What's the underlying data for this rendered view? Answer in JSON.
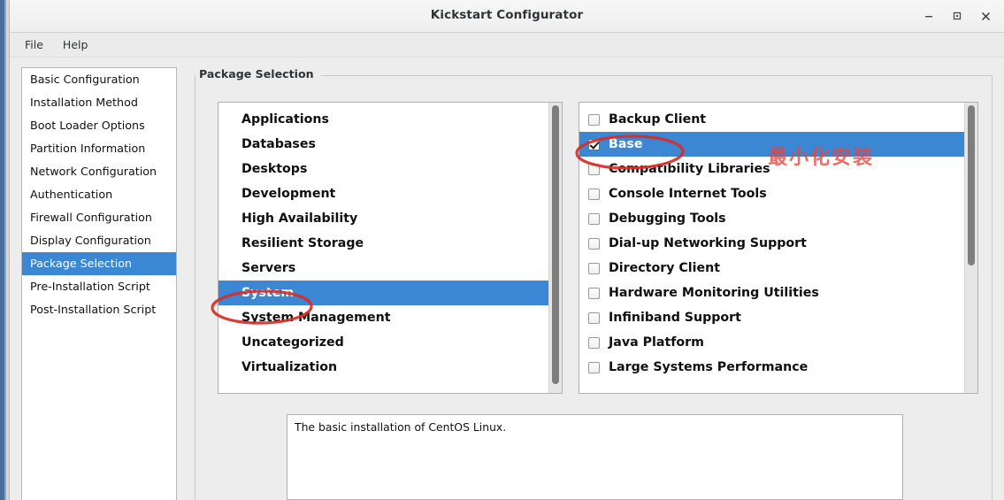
{
  "window": {
    "title": "Kickstart Configurator",
    "controls": [
      {
        "name": "minimize",
        "glyph": "—"
      },
      {
        "name": "maximize",
        "glyph": "□"
      },
      {
        "name": "close",
        "glyph": "✕"
      }
    ]
  },
  "menubar": {
    "items": [
      "File",
      "Help"
    ]
  },
  "sidebar": {
    "items": [
      {
        "label": "Basic Configuration",
        "selected": false
      },
      {
        "label": "Installation Method",
        "selected": false
      },
      {
        "label": "Boot Loader Options",
        "selected": false
      },
      {
        "label": "Partition Information",
        "selected": false
      },
      {
        "label": "Network Configuration",
        "selected": false
      },
      {
        "label": "Authentication",
        "selected": false
      },
      {
        "label": "Firewall Configuration",
        "selected": false
      },
      {
        "label": "Display Configuration",
        "selected": false
      },
      {
        "label": "Package Selection",
        "selected": true
      },
      {
        "label": "Pre-Installation Script",
        "selected": false
      },
      {
        "label": "Post-Installation Script",
        "selected": false
      }
    ]
  },
  "main": {
    "group_label": "Package Selection",
    "category_list": {
      "items": [
        {
          "label": "Applications",
          "selected": false
        },
        {
          "label": "Databases",
          "selected": false
        },
        {
          "label": "Desktops",
          "selected": false
        },
        {
          "label": "Development",
          "selected": false
        },
        {
          "label": "High Availability",
          "selected": false
        },
        {
          "label": "Resilient Storage",
          "selected": false
        },
        {
          "label": "Servers",
          "selected": false
        },
        {
          "label": "System",
          "selected": true
        },
        {
          "label": "System Management",
          "selected": false
        },
        {
          "label": "Uncategorized",
          "selected": false
        },
        {
          "label": "Virtualization",
          "selected": false
        }
      ],
      "scrollbar": {
        "thumb_top_pct": 1,
        "thumb_height_pct": 96
      }
    },
    "package_list": {
      "items": [
        {
          "label": "Backup Client",
          "checked": false,
          "selected": false
        },
        {
          "label": "Base",
          "checked": true,
          "selected": true
        },
        {
          "label": "Compatibility Libraries",
          "checked": false,
          "selected": false
        },
        {
          "label": "Console Internet Tools",
          "checked": false,
          "selected": false
        },
        {
          "label": "Debugging Tools",
          "checked": false,
          "selected": false
        },
        {
          "label": "Dial-up Networking Support",
          "checked": false,
          "selected": false
        },
        {
          "label": "Directory Client",
          "checked": false,
          "selected": false
        },
        {
          "label": "Hardware Monitoring Utilities",
          "checked": false,
          "selected": false
        },
        {
          "label": "Infiniband Support",
          "checked": false,
          "selected": false
        },
        {
          "label": "Java Platform",
          "checked": false,
          "selected": false
        },
        {
          "label": "Large Systems Performance",
          "checked": false,
          "selected": false
        }
      ],
      "scrollbar": {
        "thumb_top_pct": 1,
        "thumb_height_pct": 55
      }
    },
    "description": "The basic installation of CentOS Linux."
  },
  "annotations": {
    "accent_color": "#e03a30",
    "cjk_note": "最小化安装",
    "ellipse_system": "System",
    "ellipse_base": "Base"
  },
  "colors": {
    "selection_blue": "#3b87d3",
    "window_bg": "#ededed",
    "list_bg": "#ffffff",
    "annotation_red": "#e03a30"
  }
}
